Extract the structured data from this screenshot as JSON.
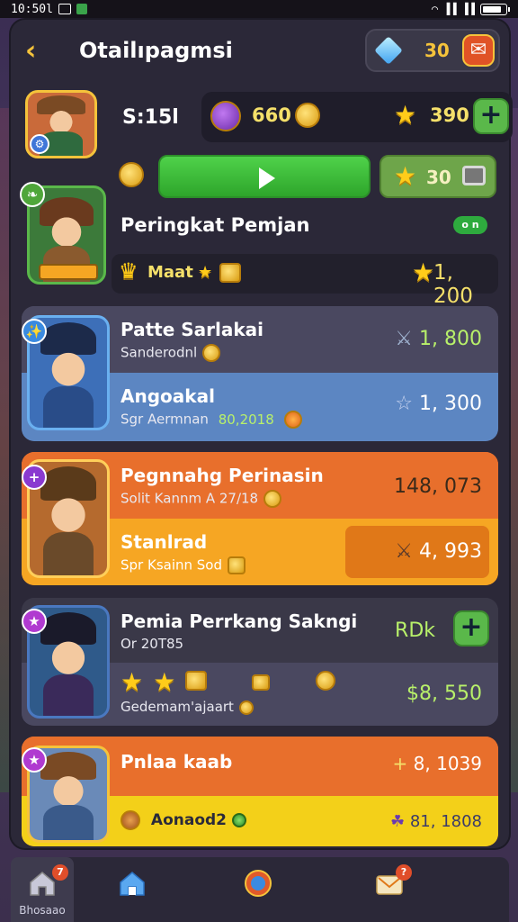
{
  "status_bar": {
    "time": "10:50l"
  },
  "header": {
    "title": "Otailıpagmsi",
    "gem_count": "30"
  },
  "profile": {
    "score": "S:15l",
    "stat_coin_value": "660",
    "stat_star_value": "390",
    "play_star_value": "30"
  },
  "ranking": {
    "title": "Peringkat Pemjan",
    "online_label": "o n",
    "sub_label": "Maat",
    "value": "1, 200"
  },
  "cards": [
    {
      "top_title": "Patte Sarlakai",
      "top_sub": "Sanderodnl",
      "top_value": "1, 800",
      "bot_title": "Angoakal",
      "bot_sub": "Sgr Aermnan",
      "bot_sub2": "80,2018",
      "bot_value": "1, 300"
    },
    {
      "top_title": "Pegnnahg Perinasin",
      "top_sub": "Solit Kannm A 27/18",
      "top_value": "148, 073",
      "bot_title": "Stanlrad",
      "bot_sub": "Spr Ksainn Sod",
      "bot_value": "4, 993"
    },
    {
      "top_title": "Pemia Perrkang Sakngi",
      "top_sub": "Or 20T85",
      "top_value": "RDk",
      "bot_sub": "Gedemam'ajaart",
      "bot_value": "$8, 550"
    },
    {
      "top_title": "Pnlaa kaab",
      "top_value": "8, 1039",
      "bot_title": "Aonaod2",
      "bot_value": "81, 1808"
    }
  ],
  "nav": {
    "items": [
      {
        "label": "Bhosaao",
        "icon": "home-icon",
        "notif": "7"
      },
      {
        "label": "",
        "icon": "home-icon"
      },
      {
        "label": "",
        "icon": "globe-icon"
      },
      {
        "label": "",
        "icon": "mail-icon",
        "notif": "?"
      }
    ]
  },
  "colors": {
    "panel": "#2b2838",
    "accent_gold": "#f5c33b",
    "green": "#3cbf38",
    "orange": "#e8742c",
    "yellow": "#f3d019",
    "blue_row": "#5c86c2"
  }
}
